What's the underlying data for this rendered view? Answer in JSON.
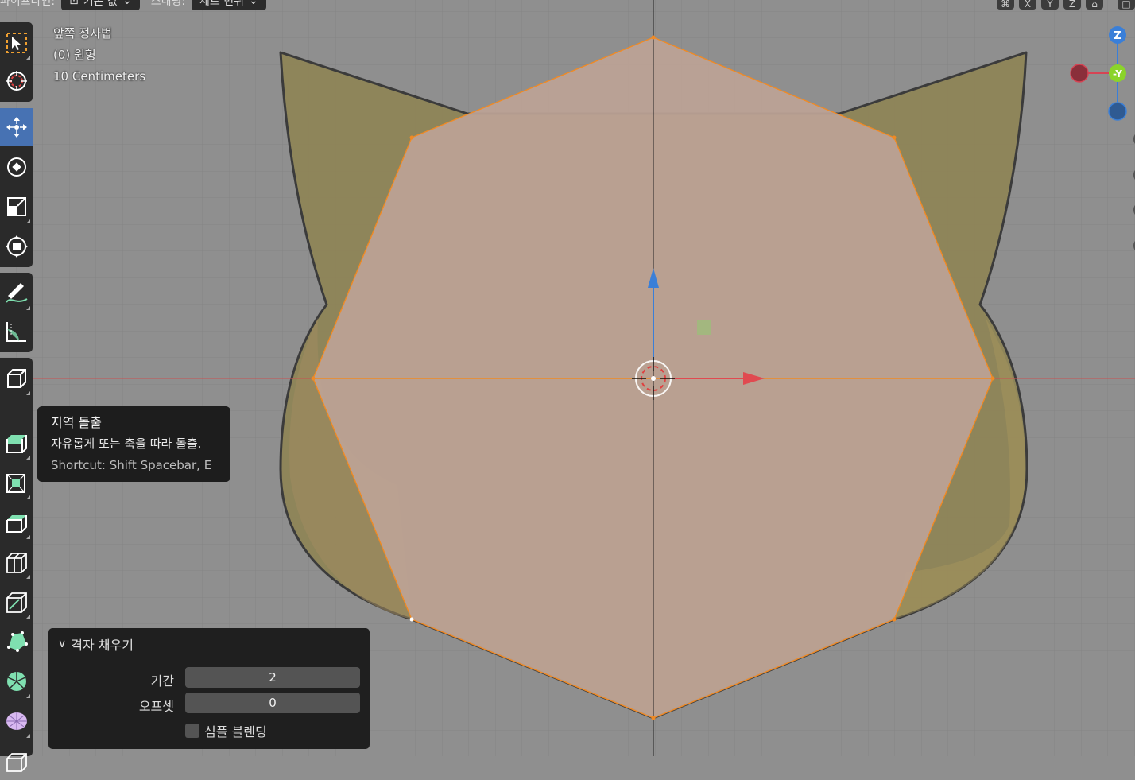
{
  "header": {
    "left_label": "파이프라인:",
    "pivot_value": "기본 값",
    "snap_label": "스내핑:",
    "snap_value": "세트 변위",
    "axis_buttons": [
      "X",
      "Y",
      "Z"
    ]
  },
  "overlay": {
    "view_name": "앞쪽 정사법",
    "object_name": "(0) 원형",
    "grid_scale": "10 Centimeters"
  },
  "toolbar": {
    "tools": [
      {
        "name": "select-box-tool",
        "icon": "select-box-icon",
        "active": false
      },
      {
        "name": "cursor-tool",
        "icon": "cursor-icon",
        "active": false
      },
      {
        "name": "move-tool",
        "icon": "move-icon",
        "active": true
      },
      {
        "name": "rotate-tool",
        "icon": "rotate-icon",
        "active": false
      },
      {
        "name": "scale-tool",
        "icon": "scale-icon",
        "active": false
      },
      {
        "name": "transform-tool",
        "icon": "transform-icon",
        "active": false
      },
      {
        "name": "annotate-tool",
        "icon": "annotate-icon",
        "active": false
      },
      {
        "name": "measure-tool",
        "icon": "measure-icon",
        "active": false
      },
      {
        "name": "add-cube-tool",
        "icon": "add-cube-icon",
        "active": false
      },
      {
        "name": "extrude-region-tool",
        "icon": "extrude-region-icon",
        "active": false
      },
      {
        "name": "inset-faces-tool",
        "icon": "inset-faces-icon",
        "active": false
      },
      {
        "name": "bevel-tool",
        "icon": "bevel-icon",
        "active": false
      },
      {
        "name": "loop-cut-tool",
        "icon": "loop-cut-icon",
        "active": false
      },
      {
        "name": "knife-tool",
        "icon": "knife-icon",
        "active": false
      },
      {
        "name": "poly-build-tool",
        "icon": "poly-build-icon",
        "active": false
      },
      {
        "name": "spin-tool",
        "icon": "spin-icon",
        "active": false
      },
      {
        "name": "smooth-tool",
        "icon": "smooth-icon",
        "active": false
      },
      {
        "name": "shear-tool",
        "icon": "shear-icon",
        "active": false
      }
    ]
  },
  "tooltip": {
    "title": "지역 돌출",
    "description": "자유롭게 또는 축을 따라 돌출.",
    "shortcut": "Shortcut: Shift Spacebar, E"
  },
  "gizmo": {
    "z_label": "Z",
    "y_label": "-Y",
    "colors": {
      "x": "#d64454",
      "y": "#8bd42a",
      "z": "#3a7fd8"
    }
  },
  "operator_panel": {
    "title": "격자 채우기",
    "span_label": "기간",
    "span_value": "2",
    "offset_label": "오프셋",
    "offset_value": "0",
    "simple_blending_label": "심플 블렌딩",
    "simple_blending_checked": false
  },
  "colors": {
    "viewport_bg": "#8f8f8f",
    "grid_line": "#838383",
    "x_axis": "#c95050",
    "selection_orange": "#f08a24",
    "face_fill": "#bca296",
    "reference_fill": "#8e8456",
    "active_tool": "#4772b3"
  }
}
